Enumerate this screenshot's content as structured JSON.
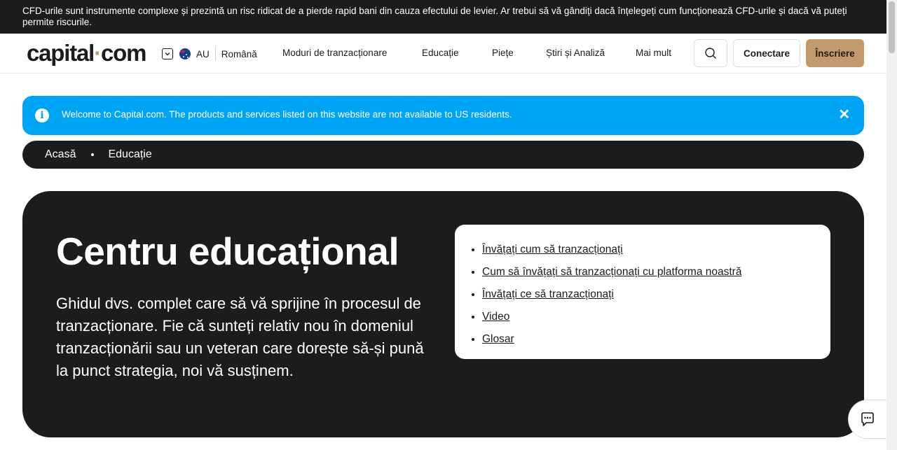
{
  "risk_warning": "CFD-urile sunt instrumente complexe și prezintă un risc ridicat de a pierde rapid bani din cauza efectului de levier. Ar trebui să vă gândiți dacă înțelegeți cum funcționează CFD-urile și dacă vă puteți permite riscurile.",
  "header": {
    "logo_left": "capital",
    "logo_dot": "·",
    "logo_right": "com",
    "region": "AU",
    "language": "Română",
    "nav": [
      "Moduri de tranzacționare",
      "Educație",
      "Piețe",
      "Știri și Analiză",
      "Mai mult"
    ],
    "login_label": "Conectare",
    "signup_label": "Înscriere"
  },
  "alert": {
    "message": "Welcome to Capital.com. The products and services listed on this website are not available to US residents.",
    "close": "✕"
  },
  "breadcrumb": [
    "Acasă",
    "Educație"
  ],
  "hero": {
    "title": "Centru educațional",
    "description": "Ghidul dvs. complet care să vă sprijine în procesul de tranzacționare. Fie că sunteți relativ nou în domeniul tranzacționării sau un veteran care dorește să-și pună la punct strategia, noi vă susținem.",
    "links": [
      "Învățați cum să tranzacționați",
      "Cum să învățați să tranzacționați cu platforma noastră",
      "Învățați ce să tranzacționați",
      "Video",
      "Glosar"
    ]
  },
  "icons": {
    "info": "i",
    "search": "search-icon",
    "chat": "chat-icon"
  },
  "colors": {
    "accent": "#c39a6b",
    "alert_bg": "#00a4f5",
    "dark": "#1c1c1c"
  }
}
